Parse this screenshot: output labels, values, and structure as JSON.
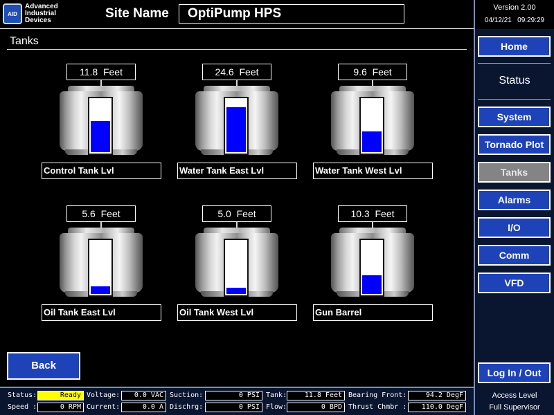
{
  "header": {
    "logo_badge": "AID",
    "logo_lines": [
      "Advanced",
      "Industrial",
      "Devices"
    ],
    "site_label": "Site Name",
    "site_name": "OptiPump HPS"
  },
  "system": {
    "version": "Version 2.00",
    "date": "04/12/21",
    "time": "09:29:29"
  },
  "nav": {
    "home": "Home",
    "status_heading": "Status",
    "items": [
      {
        "label": "System",
        "active": false
      },
      {
        "label": "Tornado Plot",
        "active": false
      },
      {
        "label": "Tanks",
        "active": true
      },
      {
        "label": "Alarms",
        "active": false
      },
      {
        "label": "I/O",
        "active": false
      },
      {
        "label": "Comm",
        "active": false
      },
      {
        "label": "VFD",
        "active": false
      }
    ],
    "login": "Log In / Out"
  },
  "page": {
    "title": "Tanks",
    "back": "Back"
  },
  "tanks": [
    {
      "readout": "11.8  Feet",
      "name": "Control Tank Lvl",
      "level_fraction": 0.59
    },
    {
      "readout": "24.6  Feet",
      "name": "Water Tank East Lvl",
      "level_fraction": 0.86
    },
    {
      "readout": "9.6  Feet",
      "name": "Water Tank West Lvl",
      "level_fraction": 0.4
    },
    {
      "readout": "5.6  Feet",
      "name": "Oil Tank East Lvl",
      "level_fraction": 0.14
    },
    {
      "readout": "5.0  Feet",
      "name": "Oil Tank West Lvl",
      "level_fraction": 0.12
    },
    {
      "readout": "10.3  Feet",
      "name": "Gun Barrel",
      "level_fraction": 0.35
    }
  ],
  "status_bar": {
    "status_label": "Status:",
    "status_value": "Ready",
    "speed_label": "Speed :",
    "speed_value": "0 RPM",
    "voltage_label": "Voltage:",
    "voltage_value": "0.0 VAC",
    "current_label": "Current:",
    "current_value": "0.0 A",
    "suction_label": "Suction:",
    "suction_value": "0 PSI",
    "discharge_label": "Dischrg:",
    "discharge_value": "0 PSI",
    "tank_label": "Tank:",
    "tank_value": "11.8 Feet",
    "flow_label": "Flow:",
    "flow_value": "0 BPD",
    "bearing_label": "Bearing Front:",
    "bearing_value": "94.2 DegF",
    "thrust_label": "Thrust Chmbr :",
    "thrust_value": "110.0 DegF"
  },
  "access": {
    "label": "Access Level",
    "user": "Full Supervisor"
  },
  "colors": {
    "button_blue": "#1e42b8",
    "active_gray": "#848484",
    "fill_blue": "#0000ff",
    "ready_yellow": "#ffff00"
  }
}
